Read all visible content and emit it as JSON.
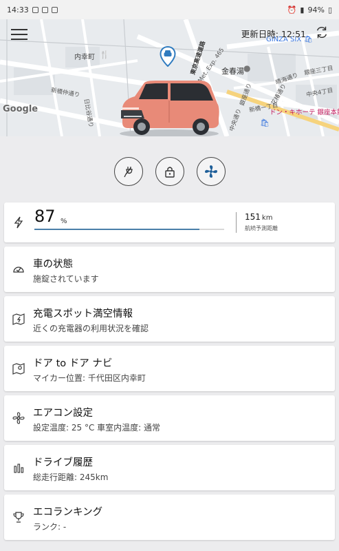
{
  "status_bar": {
    "time": "14:33",
    "battery": "94%"
  },
  "header": {
    "update_label": "更新日時: 12:51",
    "menu_icon": "hamburger-menu-icon",
    "refresh_icon": "refresh-icon"
  },
  "map": {
    "labels": {
      "uchisaiwai": "内幸町",
      "ginza_six": "GINZA SIX",
      "konparuyu": "金春湯",
      "donki": "ドン・キホーテ 銀座本館",
      "shimbashi": "新橋仲通り",
      "hibiya": "日比谷通り",
      "ginza_dori": "銀座通り",
      "chuo_dori": "中央通り",
      "hanatsubaki": "花椿通り",
      "shinbashi_ginza": "新橋ー丁目",
      "expressway": "東京高速道路",
      "metro": "Met. Exp. 465",
      "ginza_3": "銀座三丁目",
      "chuo_4": "中央4丁目",
      "harumi": "晴海通り"
    },
    "provider": "Google"
  },
  "quick_actions": [
    {
      "name": "charge-button",
      "icon": "charging-plug-icon"
    },
    {
      "name": "lock-button",
      "icon": "lock-icon"
    },
    {
      "name": "climate-button",
      "icon": "fan-icon"
    }
  ],
  "battery": {
    "percent": "87",
    "percent_unit": "%",
    "level_fraction": 0.87,
    "range_value": "151",
    "range_unit": "km",
    "range_label": "航続予測距離",
    "accent": "#4a7fa8"
  },
  "menu": [
    {
      "key": "vehicle-status",
      "icon": "gauge-check-icon",
      "title": "車の状態",
      "subtitle": "施錠されています"
    },
    {
      "key": "charging-spot",
      "icon": "map-charging-icon",
      "title": "充電スポット満空情報",
      "subtitle": "近くの充電器の利用状況を確認"
    },
    {
      "key": "door-to-door",
      "icon": "map-pin-icon",
      "title": "ドア to ドア ナビ",
      "subtitle": "マイカー位置: 千代田区内幸町"
    },
    {
      "key": "air-conditioner",
      "icon": "fan-icon",
      "title": "エアコン設定",
      "subtitle": "設定温度: 25 °C  車室内温度: 通常"
    },
    {
      "key": "drive-history",
      "icon": "bar-chart-icon",
      "title": "ドライブ履歴",
      "subtitle": "総走行距離: 245km"
    },
    {
      "key": "eco-ranking",
      "icon": "trophy-icon",
      "title": "エコランキング",
      "subtitle": "ランク: -"
    }
  ]
}
